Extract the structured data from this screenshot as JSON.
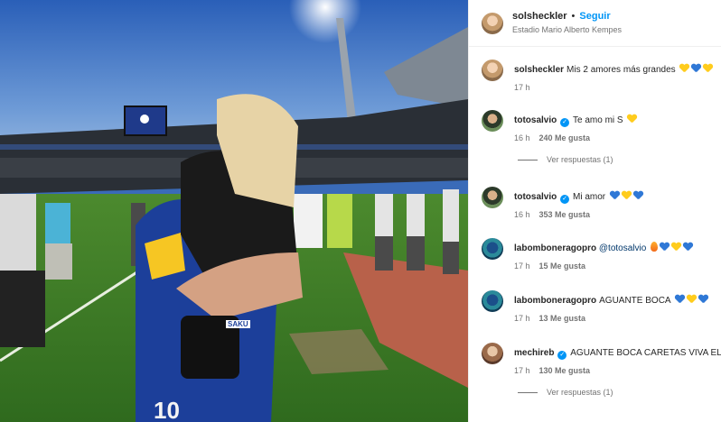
{
  "header": {
    "username": "solsheckler",
    "separator": "•",
    "follow_label": "Seguir",
    "location": "Estadio Mario Alberto Kempes"
  },
  "photo": {
    "jersey_number": "10",
    "jersey_tag": "SAKU"
  },
  "comments": [
    {
      "username": "solsheckler",
      "verified": false,
      "text": "Mis 2 amores más grandes",
      "emojis": [
        "yellow-heart",
        "blue-heart",
        "yellow-heart"
      ],
      "time": "17 h",
      "likes": "",
      "replies": ""
    },
    {
      "username": "totosalvio",
      "verified": true,
      "text": "Te amo mi S",
      "emojis": [
        "yellow-heart"
      ],
      "time": "16 h",
      "likes": "240 Me gusta",
      "replies": "Ver respuestas (1)"
    },
    {
      "username": "totosalvio",
      "verified": true,
      "text": "Mi amor",
      "emojis": [
        "blue-heart",
        "yellow-heart",
        "blue-heart"
      ],
      "time": "16 h",
      "likes": "353 Me gusta",
      "replies": ""
    },
    {
      "username": "labomboneragopro",
      "verified": false,
      "mention": "@totosalvio",
      "text": "",
      "emojis": [
        "flame",
        "blue-heart",
        "yellow-heart",
        "blue-heart"
      ],
      "time": "17 h",
      "likes": "15 Me gusta",
      "replies": ""
    },
    {
      "username": "labomboneragopro",
      "verified": false,
      "text": "AGUANTE BOCA",
      "emojis": [
        "blue-heart",
        "yellow-heart",
        "blue-heart"
      ],
      "time": "17 h",
      "likes": "13 Me gusta",
      "replies": ""
    },
    {
      "username": "mechireb",
      "verified": true,
      "text": "AGUANTE BOCA CARETAS VIVA EL",
      "emojis": [],
      "time": "17 h",
      "likes": "130 Me gusta",
      "replies": "Ver respuestas (1)"
    }
  ],
  "colors": {
    "follow": "#0095f6",
    "verified": "#0095f6",
    "blue_heart": "#2f78d6",
    "yellow_heart": "#ffcc1d"
  }
}
